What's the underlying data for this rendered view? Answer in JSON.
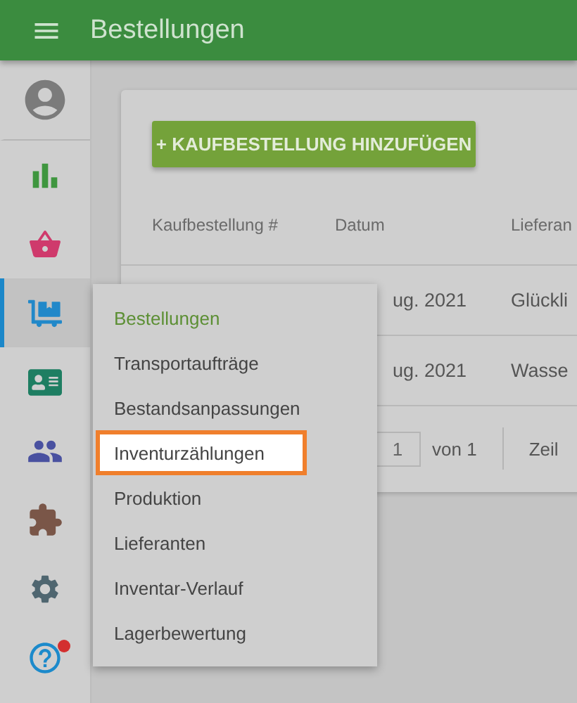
{
  "app_bar": {
    "title": "Bestellungen"
  },
  "sidebar": {
    "items": [
      {
        "kind": "avatar",
        "selected": false,
        "notification": false
      },
      {
        "kind": "chart",
        "selected": false,
        "notification": false
      },
      {
        "kind": "basket",
        "selected": false,
        "notification": false
      },
      {
        "kind": "dolly",
        "selected": true,
        "notification": false
      },
      {
        "kind": "card",
        "selected": false,
        "notification": false
      },
      {
        "kind": "people",
        "selected": false,
        "notification": false
      },
      {
        "kind": "puzzle",
        "selected": false,
        "notification": false
      },
      {
        "kind": "gear",
        "selected": false,
        "notification": false
      },
      {
        "kind": "help",
        "selected": false,
        "notification": true
      }
    ]
  },
  "page": {
    "add_button": "+ KAUFBESTELLUNG HINZUFÜGEN",
    "table": {
      "columns": [
        "Kaufbestellung #",
        "Datum",
        "Lieferan"
      ],
      "rows": [
        {
          "column_2": "ug. 2021",
          "column_3": "Glückli"
        },
        {
          "column_2": "ug. 2021",
          "column_3": "Wasse"
        }
      ]
    },
    "pagination": {
      "page": "1",
      "of": "von 1",
      "rows_label": "Zeil"
    }
  },
  "menu": {
    "items": [
      {
        "label": "Bestellungen",
        "selected": true,
        "highlighted": false
      },
      {
        "label": "Transportaufträge",
        "selected": false,
        "highlighted": false
      },
      {
        "label": "Bestandsanpassungen",
        "selected": false,
        "highlighted": false
      },
      {
        "label": "Inventurzählungen",
        "selected": false,
        "highlighted": true
      },
      {
        "label": "Produktion",
        "selected": false,
        "highlighted": false
      },
      {
        "label": "Lieferanten",
        "selected": false,
        "highlighted": false
      },
      {
        "label": "Inventar-Verlauf",
        "selected": false,
        "highlighted": false
      },
      {
        "label": "Lagerbewertung",
        "selected": false,
        "highlighted": false
      }
    ]
  }
}
